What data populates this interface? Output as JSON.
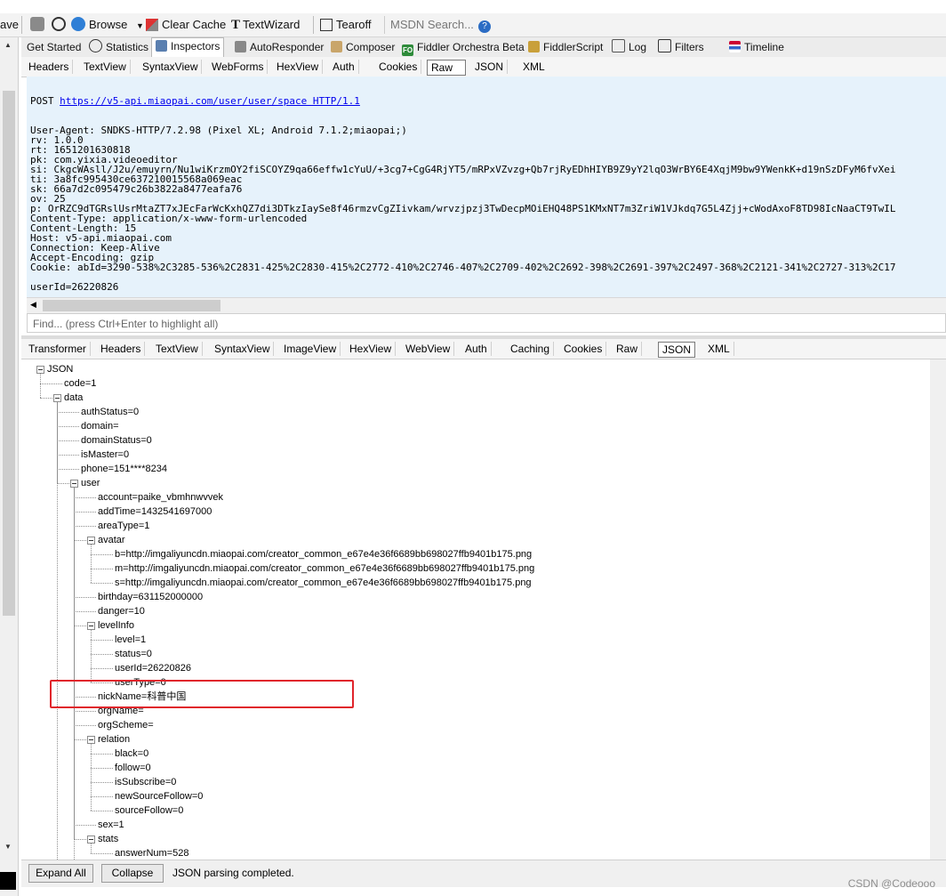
{
  "toolbar": {
    "save": "ave",
    "browse": "Browse",
    "clear_cache": "Clear Cache",
    "textwizard": "TextWizard",
    "tearoff": "Tearoff",
    "search_placeholder": "MSDN Search..."
  },
  "top_tabs": [
    "Get Started",
    "Statistics",
    "Inspectors",
    "AutoResponder",
    "Composer",
    "Fiddler Orchestra Beta",
    "FiddlerScript",
    "Log",
    "Filters",
    "Timeline"
  ],
  "request_tabs": [
    "Headers",
    "TextView",
    "SyntaxView",
    "WebForms",
    "HexView",
    "Auth",
    "Cookies",
    "Raw",
    "JSON",
    "XML"
  ],
  "raw_request": {
    "method": "POST ",
    "url": "https://v5-api.miaopai.com/user/user/space HTTP/1.1",
    "lines": [
      "User-Agent: SNDKS-HTTP/7.2.98 (Pixel XL; Android 7.1.2;miaopai;)",
      "rv: 1.0.0",
      "rt: 1651201630818",
      "pk: com.yixia.videoeditor",
      "si: CkgcWAsll/J2u/emuyrn/Nu1wiKrzmOY2fiSCOYZ9qa66effw1cYuU/+3cg7+CgG4RjYT5/mRPxVZvzg+Qb7rjRyEDhHIYB9Z9yY2lqO3WrBY6E4XqjM9bw9YWenkK+d19nSzDFyM6fvXei",
      "ti: 3a8fc995430ce637210015568a069eac",
      "sk: 66a7d2c095479c26b3822a8477eafa76",
      "ov: 25",
      "p: OrRZC9dTGRslUsrMtaZT7xJEcFarWcKxhQZ7di3DTkzIaySe8f46rmzvCgZIivkam/wrvzjpzj3TwDecpMOiEHQ48PS1KMxNT7m3ZriW1VJkdq7G5L4Zjj+cWodAxoF8TD98IcNaaCT9TwIL",
      "Content-Type: application/x-www-form-urlencoded",
      "Content-Length: 15",
      "Host: v5-api.miaopai.com",
      "Connection: Keep-Alive",
      "Accept-Encoding: gzip",
      "Cookie: abId=3290-538%2C3285-536%2C2831-425%2C2830-415%2C2772-410%2C2746-407%2C2709-402%2C2692-398%2C2691-397%2C2497-368%2C2121-341%2C2727-313%2C17",
      "",
      "userId=26220826"
    ]
  },
  "find_placeholder": "Find... (press Ctrl+Enter to highlight all)",
  "response_tabs": [
    "Transformer",
    "Headers",
    "TextView",
    "SyntaxView",
    "ImageView",
    "HexView",
    "WebView",
    "Auth",
    "Caching",
    "Cookies",
    "Raw",
    "JSON",
    "XML"
  ],
  "tree": [
    {
      "t": "JSON",
      "d": 0,
      "c": true
    },
    {
      "t": "code=1",
      "d": 1
    },
    {
      "t": "data",
      "d": 1,
      "c": true
    },
    {
      "t": "authStatus=0",
      "d": 2
    },
    {
      "t": "domain=",
      "d": 2
    },
    {
      "t": "domainStatus=0",
      "d": 2
    },
    {
      "t": "isMaster=0",
      "d": 2
    },
    {
      "t": "phone=151****8234",
      "d": 2
    },
    {
      "t": "user",
      "d": 2,
      "c": true
    },
    {
      "t": "account=paike_vbmhnwvvek",
      "d": 3
    },
    {
      "t": "addTime=1432541697000",
      "d": 3
    },
    {
      "t": "areaType=1",
      "d": 3
    },
    {
      "t": "avatar",
      "d": 3,
      "c": true
    },
    {
      "t": "b=http://imgaliyuncdn.miaopai.com/creator_common_e67e4e36f6689bb698027ffb9401b175.png",
      "d": 4
    },
    {
      "t": "m=http://imgaliyuncdn.miaopai.com/creator_common_e67e4e36f6689bb698027ffb9401b175.png",
      "d": 4
    },
    {
      "t": "s=http://imgaliyuncdn.miaopai.com/creator_common_e67e4e36f6689bb698027ffb9401b175.png",
      "d": 4
    },
    {
      "t": "birthday=631152000000",
      "d": 3
    },
    {
      "t": "danger=10",
      "d": 3
    },
    {
      "t": "levelInfo",
      "d": 3,
      "c": true
    },
    {
      "t": "level=1",
      "d": 4
    },
    {
      "t": "status=0",
      "d": 4
    },
    {
      "t": "userId=26220826",
      "d": 4
    },
    {
      "t": "userType=0",
      "d": 4
    },
    {
      "t": "nickName=科普中国",
      "d": 3
    },
    {
      "t": "orgName=",
      "d": 3
    },
    {
      "t": "orgScheme=",
      "d": 3
    },
    {
      "t": "relation",
      "d": 3,
      "c": true
    },
    {
      "t": "black=0",
      "d": 4
    },
    {
      "t": "follow=0",
      "d": 4
    },
    {
      "t": "isSubscribe=0",
      "d": 4
    },
    {
      "t": "newSourceFollow=0",
      "d": 4
    },
    {
      "t": "sourceFollow=0",
      "d": 4
    },
    {
      "t": "sex=1",
      "d": 3
    },
    {
      "t": "stats",
      "d": 3,
      "c": true
    },
    {
      "t": "answerNum=528",
      "d": 4
    }
  ],
  "bottom": {
    "expand_all": "Expand All",
    "collapse": "Collapse",
    "status": "JSON parsing completed."
  },
  "watermark": "CSDN @Codeooo"
}
